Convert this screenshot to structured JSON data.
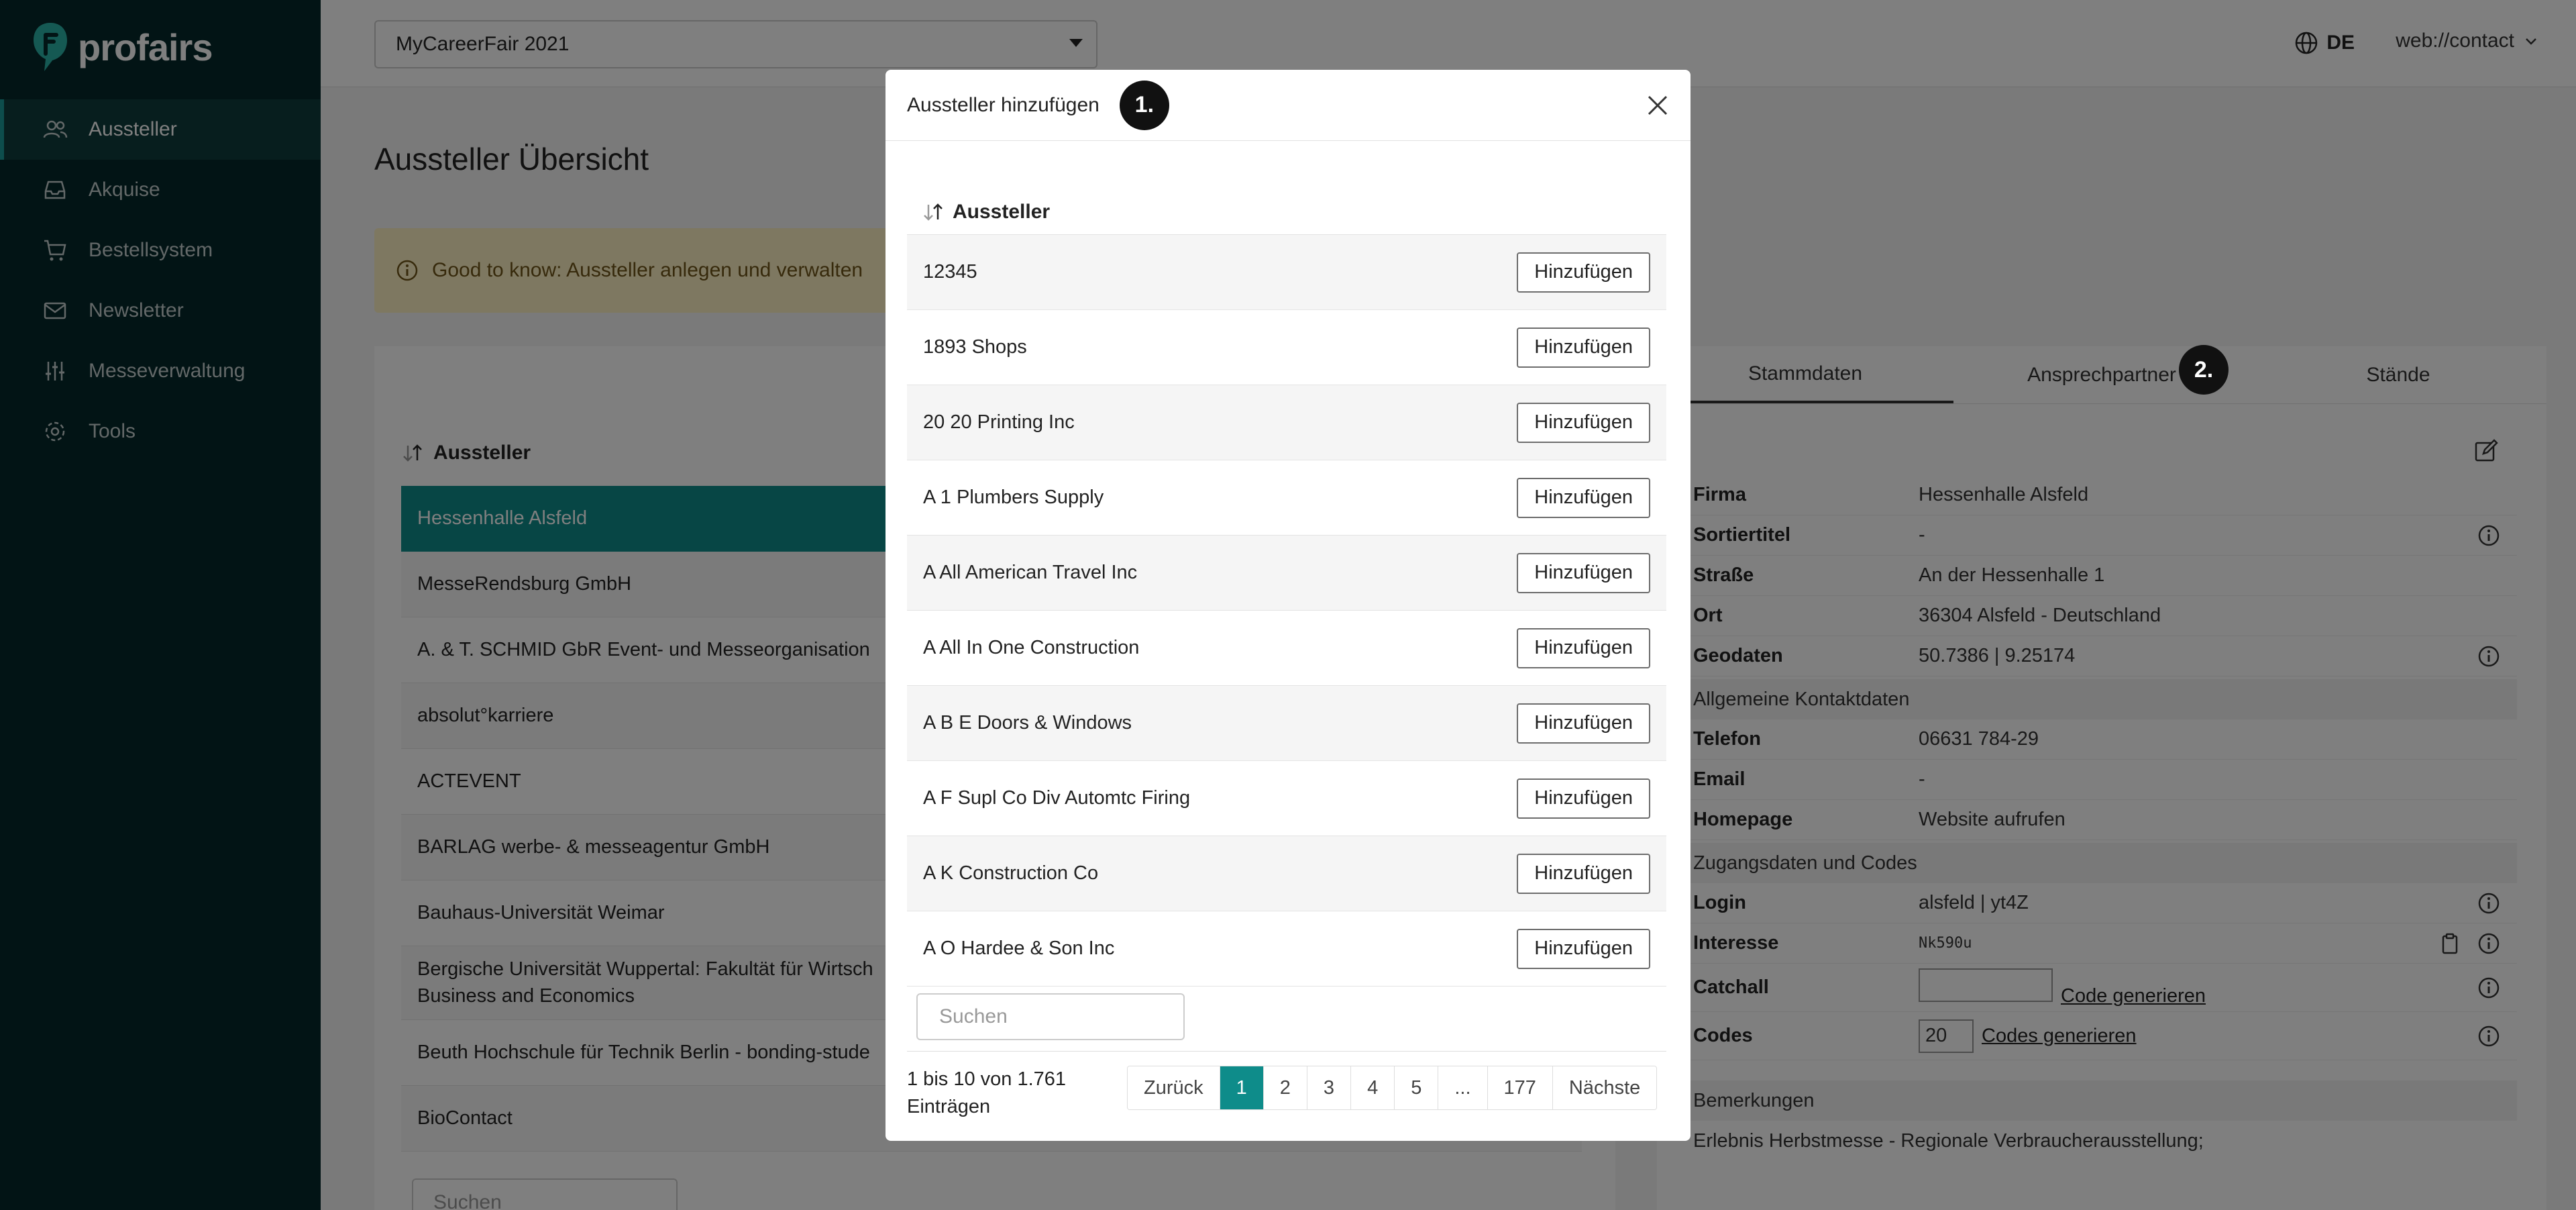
{
  "brand": {
    "name": "profairs",
    "accent": "#0e8c8a",
    "sidebar_bg": "#05292a"
  },
  "sidebar": {
    "items": [
      {
        "label": "Aussteller",
        "icon": "users-icon",
        "active": true
      },
      {
        "label": "Akquise",
        "icon": "inbox-icon"
      },
      {
        "label": "Bestellsystem",
        "icon": "cart-icon"
      },
      {
        "label": "Newsletter",
        "icon": "mail-icon"
      },
      {
        "label": "Messeverwaltung",
        "icon": "sliders-icon"
      },
      {
        "label": "Tools",
        "icon": "gear-icon"
      }
    ]
  },
  "topbar": {
    "fair_select": "MyCareerFair 2021",
    "language": "DE",
    "user": "web://contact"
  },
  "page": {
    "title": "Aussteller Übersicht",
    "info_banner": "Good to know: Aussteller anlegen und verwalten"
  },
  "exhibitor_list": {
    "header": "Aussteller",
    "rows": [
      "Hessenhalle Alsfeld",
      "MesseRendsburg GmbH",
      "A. & T. SCHMID GbR Event- und Messeorganisation",
      "absolut°karriere",
      "ACTEVENT",
      "BARLAG werbe- & messeagentur GmbH",
      "Bauhaus-Universität Weimar",
      "Bergische Universität Wuppertal: Fakultät für Wirtsch",
      "Business and Economics",
      "Beuth Hochschule für Technik Berlin - bonding-stude",
      "BioContact"
    ],
    "search_placeholder": "Suchen"
  },
  "detail": {
    "tabs": [
      "Stammdaten",
      "Ansprechpartner",
      "Stände"
    ],
    "fields": {
      "firma_label": "Firma",
      "firma_value": "Hessenhalle Alsfeld",
      "sortiertitel_label": "Sortiertitel",
      "sortiertitel_value": "-",
      "strasse_label": "Straße",
      "strasse_value": "An der Hessenhalle 1",
      "ort_label": "Ort",
      "ort_value": "36304 Alsfeld - Deutschland",
      "geodaten_label": "Geodaten",
      "geodaten_value": "50.7386 | 9.25174",
      "section_kontakt": "Allgemeine Kontaktdaten",
      "telefon_label": "Telefon",
      "telefon_value": "06631 784-29",
      "email_label": "Email",
      "email_value": "-",
      "homepage_label": "Homepage",
      "homepage_value": "Website aufrufen",
      "section_zugang": "Zugangsdaten und Codes",
      "login_label": "Login",
      "login_value": "alsfeld | yt4Z",
      "interesse_label": "Interesse",
      "interesse_value": "Nk590u",
      "catchall_label": "Catchall",
      "catchall_action": "Code generieren",
      "codes_label": "Codes",
      "codes_value": "20",
      "codes_action": "Codes generieren",
      "section_bemerkungen": "Bemerkungen",
      "bemerkungen_value": "Erlebnis Herbstmesse - Regionale Verbraucherausstellung;"
    }
  },
  "modal": {
    "title": "Aussteller hinzufügen",
    "step": "1.",
    "column": "Aussteller",
    "add_label": "Hinzufügen",
    "rows": [
      "12345",
      "1893 Shops",
      "20 20 Printing Inc",
      "A 1 Plumbers Supply",
      "A All American Travel Inc",
      "A All In One Construction",
      "A B E Doors & Windows",
      "A F Supl Co Div Automtc Firing",
      "A K Construction Co",
      "A O Hardee & Son Inc"
    ],
    "search_placeholder": "Suchen",
    "info_line1": "1 bis 10 von 1.761",
    "info_line2": "Einträgen",
    "pager": [
      "Zurück",
      "1",
      "2",
      "3",
      "4",
      "5",
      "...",
      "177",
      "Nächste"
    ]
  },
  "step2": "2."
}
